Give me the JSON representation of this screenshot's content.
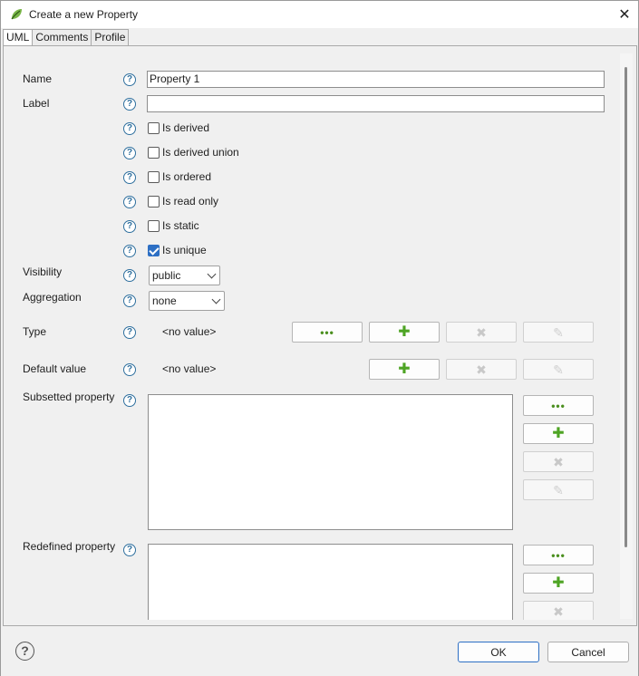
{
  "window": {
    "title": "Create a new Property",
    "close_glyph": "✕",
    "app_icon": "papyrus-leaf-icon"
  },
  "tabs": [
    {
      "label": "UML",
      "active": true
    },
    {
      "label": "Comments",
      "active": false
    },
    {
      "label": "Profile",
      "active": false
    }
  ],
  "help_glyph": "?",
  "form": {
    "name": {
      "label": "Name",
      "value": "Property 1"
    },
    "label": {
      "label": "Label",
      "value": ""
    },
    "checkboxes": [
      {
        "label": "Is derived",
        "checked": false
      },
      {
        "label": "Is derived union",
        "checked": false
      },
      {
        "label": "Is ordered",
        "checked": false
      },
      {
        "label": "Is read only",
        "checked": false
      },
      {
        "label": "Is static",
        "checked": false
      },
      {
        "label": "Is unique",
        "checked": true
      }
    ],
    "visibility": {
      "label": "Visibility",
      "value": "public"
    },
    "aggregation": {
      "label": "Aggregation",
      "value": "none"
    },
    "type": {
      "label": "Type",
      "value": "<no value>"
    },
    "default_value": {
      "label": "Default value",
      "value": "<no value>"
    },
    "subsetted_property": {
      "label": "Subsetted property"
    },
    "redefined_property": {
      "label": "Redefined property"
    }
  },
  "button_glyphs": {
    "browse": "•••",
    "add": "✚",
    "remove": "✖",
    "edit": "✎"
  },
  "footer": {
    "help_glyph": "?",
    "ok_label": "OK",
    "cancel_label": "Cancel"
  },
  "colors": {
    "accent": "#2d6fc4",
    "help_icon": "#2e6f9e",
    "add_green": "#4ea424"
  }
}
